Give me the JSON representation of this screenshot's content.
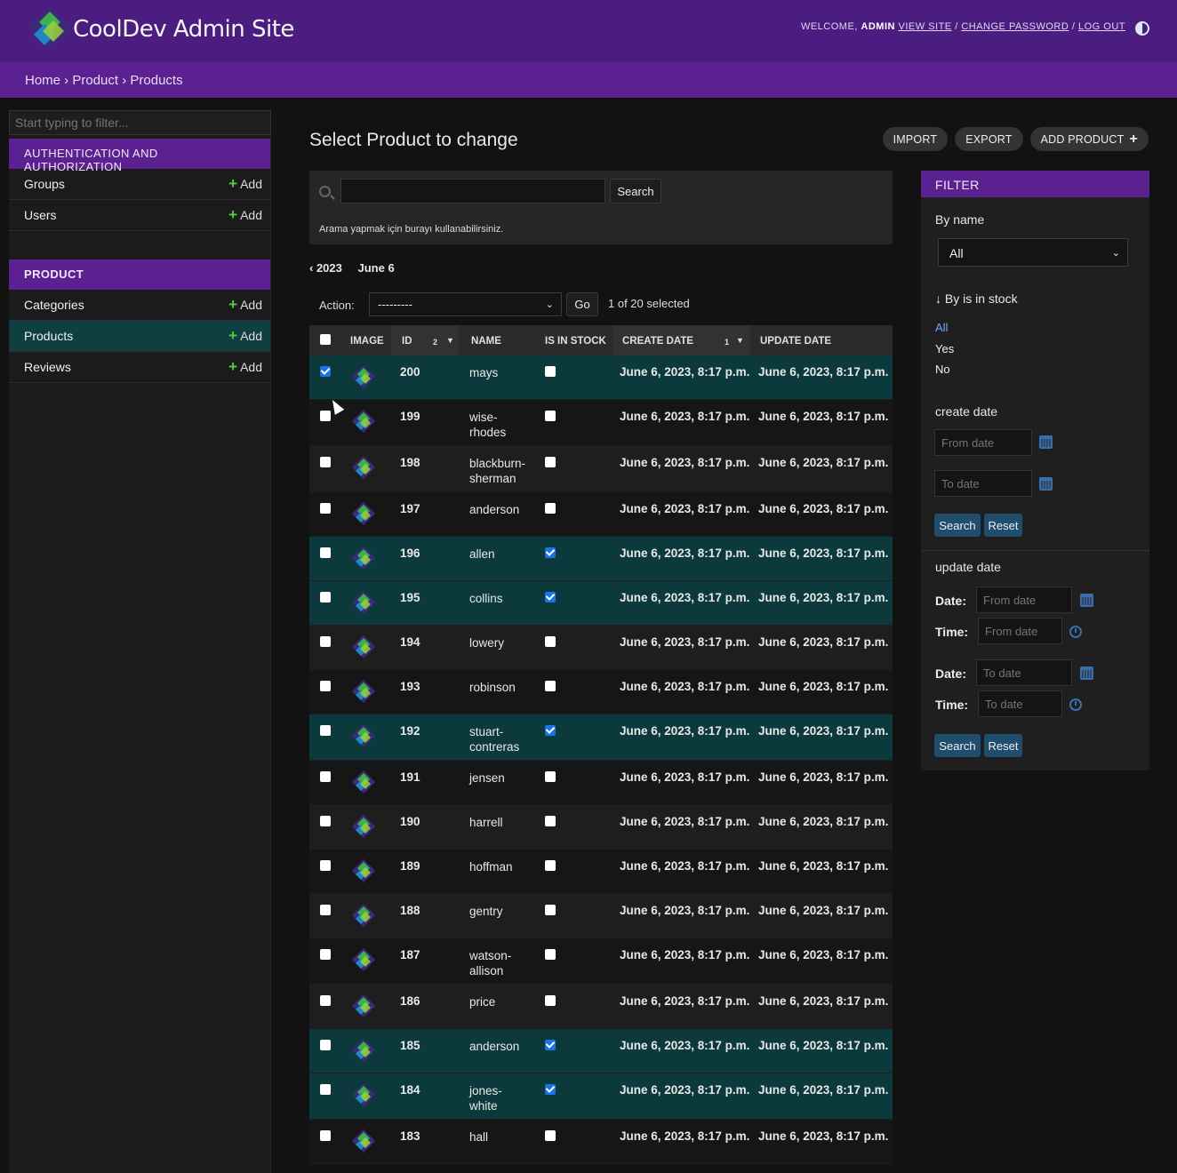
{
  "header": {
    "site_title": "CoolDev Admin Site",
    "welcome": "Welcome,",
    "username": "Admin",
    "view_site": "View site",
    "change_password": "Change password",
    "log_out": "Log out",
    "brand_color": "#4c1d80"
  },
  "breadcrumbs": [
    "Home",
    "Product",
    "Products"
  ],
  "sidebar": {
    "filter_placeholder": "Start typing to filter...",
    "modules": [
      {
        "title": "Authentication and Authorization",
        "items": [
          {
            "label": "Groups",
            "add": "Add"
          },
          {
            "label": "Users",
            "add": "Add"
          }
        ]
      },
      {
        "title": "Product",
        "items": [
          {
            "label": "Categories",
            "add": "Add"
          },
          {
            "label": "Products",
            "add": "Add"
          },
          {
            "label": "Reviews",
            "add": "Add"
          }
        ]
      }
    ]
  },
  "content": {
    "title": "Select Product to change",
    "tools": [
      "Import",
      "Export",
      "Add Product"
    ],
    "search_button": "Search",
    "search_help": "Arama yapmak için burayı kullanabilirsiniz.",
    "date_hierarchy": [
      "‹ 2023",
      "June 6"
    ],
    "action_label": "Action:",
    "action_value": "---------",
    "go": "Go",
    "selection": "1 of 20 selected"
  },
  "table": {
    "headers": [
      "Image",
      "ID",
      "Name",
      "Is in stock",
      "Create date",
      "Update date"
    ],
    "id_sort": "2",
    "create_sort": "1",
    "rows": [
      {
        "id": "200",
        "name": "mays",
        "stock": false,
        "selected": true,
        "create": "June 6, 2023, 8:17 p.m.",
        "update": "June 6, 2023, 8:17 p.m."
      },
      {
        "id": "199",
        "name": "wise-rhodes",
        "stock": false,
        "selected": false,
        "create": "June 6, 2023, 8:17 p.m.",
        "update": "June 6, 2023, 8:17 p.m."
      },
      {
        "id": "198",
        "name": "blackburn-sherman",
        "stock": false,
        "selected": false,
        "create": "June 6, 2023, 8:17 p.m.",
        "update": "June 6, 2023, 8:17 p.m."
      },
      {
        "id": "197",
        "name": "anderson",
        "stock": false,
        "selected": false,
        "create": "June 6, 2023, 8:17 p.m.",
        "update": "June 6, 2023, 8:17 p.m."
      },
      {
        "id": "196",
        "name": "allen",
        "stock": true,
        "selected": false,
        "create": "June 6, 2023, 8:17 p.m.",
        "update": "June 6, 2023, 8:17 p.m."
      },
      {
        "id": "195",
        "name": "collins",
        "stock": true,
        "selected": false,
        "create": "June 6, 2023, 8:17 p.m.",
        "update": "June 6, 2023, 8:17 p.m."
      },
      {
        "id": "194",
        "name": "lowery",
        "stock": false,
        "selected": false,
        "create": "June 6, 2023, 8:17 p.m.",
        "update": "June 6, 2023, 8:17 p.m."
      },
      {
        "id": "193",
        "name": "robinson",
        "stock": false,
        "selected": false,
        "create": "June 6, 2023, 8:17 p.m.",
        "update": "June 6, 2023, 8:17 p.m."
      },
      {
        "id": "192",
        "name": "stuart-contreras",
        "stock": true,
        "selected": false,
        "create": "June 6, 2023, 8:17 p.m.",
        "update": "June 6, 2023, 8:17 p.m."
      },
      {
        "id": "191",
        "name": "jensen",
        "stock": false,
        "selected": false,
        "create": "June 6, 2023, 8:17 p.m.",
        "update": "June 6, 2023, 8:17 p.m."
      },
      {
        "id": "190",
        "name": "harrell",
        "stock": false,
        "selected": false,
        "create": "June 6, 2023, 8:17 p.m.",
        "update": "June 6, 2023, 8:17 p.m."
      },
      {
        "id": "189",
        "name": "hoffman",
        "stock": false,
        "selected": false,
        "create": "June 6, 2023, 8:17 p.m.",
        "update": "June 6, 2023, 8:17 p.m."
      },
      {
        "id": "188",
        "name": "gentry",
        "stock": false,
        "selected": false,
        "create": "June 6, 2023, 8:17 p.m.",
        "update": "June 6, 2023, 8:17 p.m."
      },
      {
        "id": "187",
        "name": "watson-allison",
        "stock": false,
        "selected": false,
        "create": "June 6, 2023, 8:17 p.m.",
        "update": "June 6, 2023, 8:17 p.m."
      },
      {
        "id": "186",
        "name": "price",
        "stock": false,
        "selected": false,
        "create": "June 6, 2023, 8:17 p.m.",
        "update": "June 6, 2023, 8:17 p.m."
      },
      {
        "id": "185",
        "name": "anderson",
        "stock": true,
        "selected": false,
        "create": "June 6, 2023, 8:17 p.m.",
        "update": "June 6, 2023, 8:17 p.m."
      },
      {
        "id": "184",
        "name": "jones-white",
        "stock": true,
        "selected": false,
        "create": "June 6, 2023, 8:17 p.m.",
        "update": "June 6, 2023, 8:17 p.m."
      },
      {
        "id": "183",
        "name": "hall",
        "stock": false,
        "selected": false,
        "create": "June 6, 2023, 8:17 p.m.",
        "update": "June 6, 2023, 8:17 p.m."
      }
    ]
  },
  "filter": {
    "title": "Filter",
    "by_name": "By name",
    "by_name_value": "All",
    "by_stock": "↓ By is in stock",
    "stock_options": [
      "All",
      "Yes",
      "No"
    ],
    "create_date": "create date",
    "update_date": "update date",
    "from_date": "From date",
    "to_date": "To date",
    "date_label": "Date:",
    "time_label": "Time:",
    "search": "Search",
    "reset": "Reset"
  }
}
